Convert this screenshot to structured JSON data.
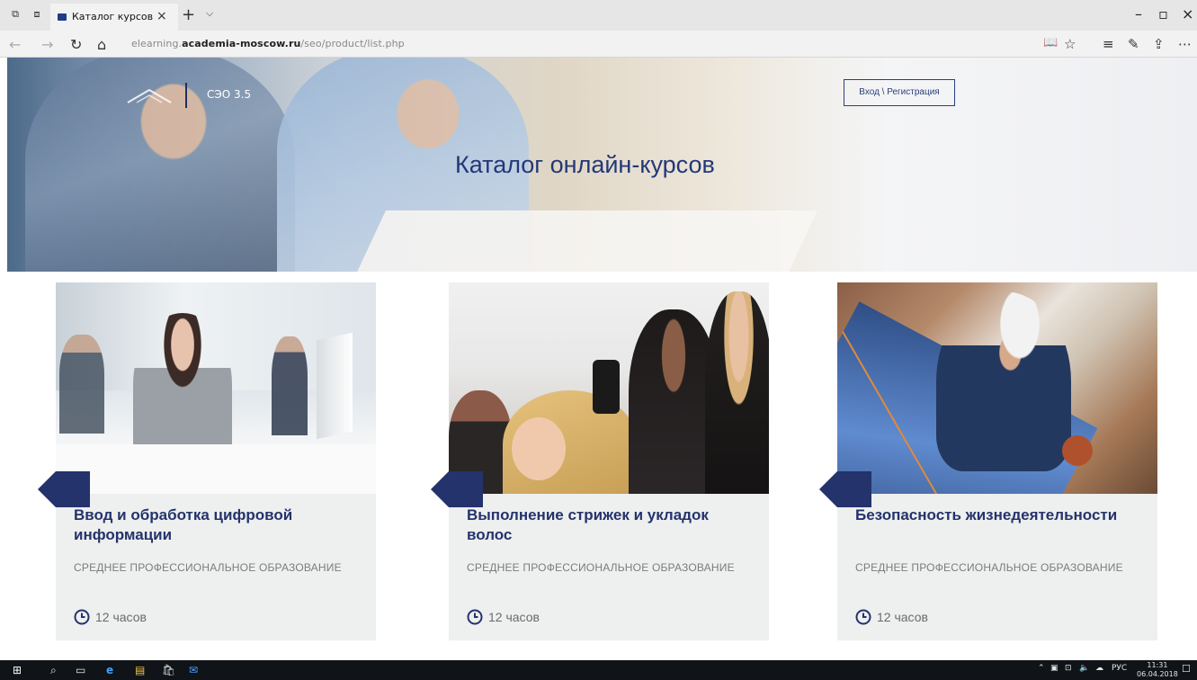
{
  "browser": {
    "tab_title": "Каталог курсов",
    "url_prefix": "elearning.",
    "url_domain": "academia-moscow.ru",
    "url_path": "/seo/product/list.php"
  },
  "hero": {
    "sdo_label": "СЭО 3.5",
    "login_button": "Вход \\ Регистрация",
    "title": "Каталог онлайн-курсов"
  },
  "cards": [
    {
      "title": "Ввод и обработка цифровой информации",
      "category": "СРЕДНЕЕ ПРОФЕССИОНАЛЬНОЕ ОБРАЗОВАНИЕ",
      "duration": "12 часов"
    },
    {
      "title": "Выполнение стрижек и укладок волос",
      "category": "СРЕДНЕЕ ПРОФЕССИОНАЛЬНОЕ ОБРАЗОВАНИЕ",
      "duration": "12 часов"
    },
    {
      "title": "Безопасность жизнедеятельности",
      "category": "СРЕДНЕЕ ПРОФЕССИОНАЛЬНОЕ ОБРАЗОВАНИЕ",
      "duration": "12 часов"
    }
  ],
  "taskbar": {
    "language": "РУС",
    "time": "11:31",
    "date": "06.04.2018"
  },
  "colors": {
    "brand": "#24336b",
    "hero_title": "#233877",
    "card_bg": "#eeefef",
    "muted_text": "#7c7c7c"
  }
}
